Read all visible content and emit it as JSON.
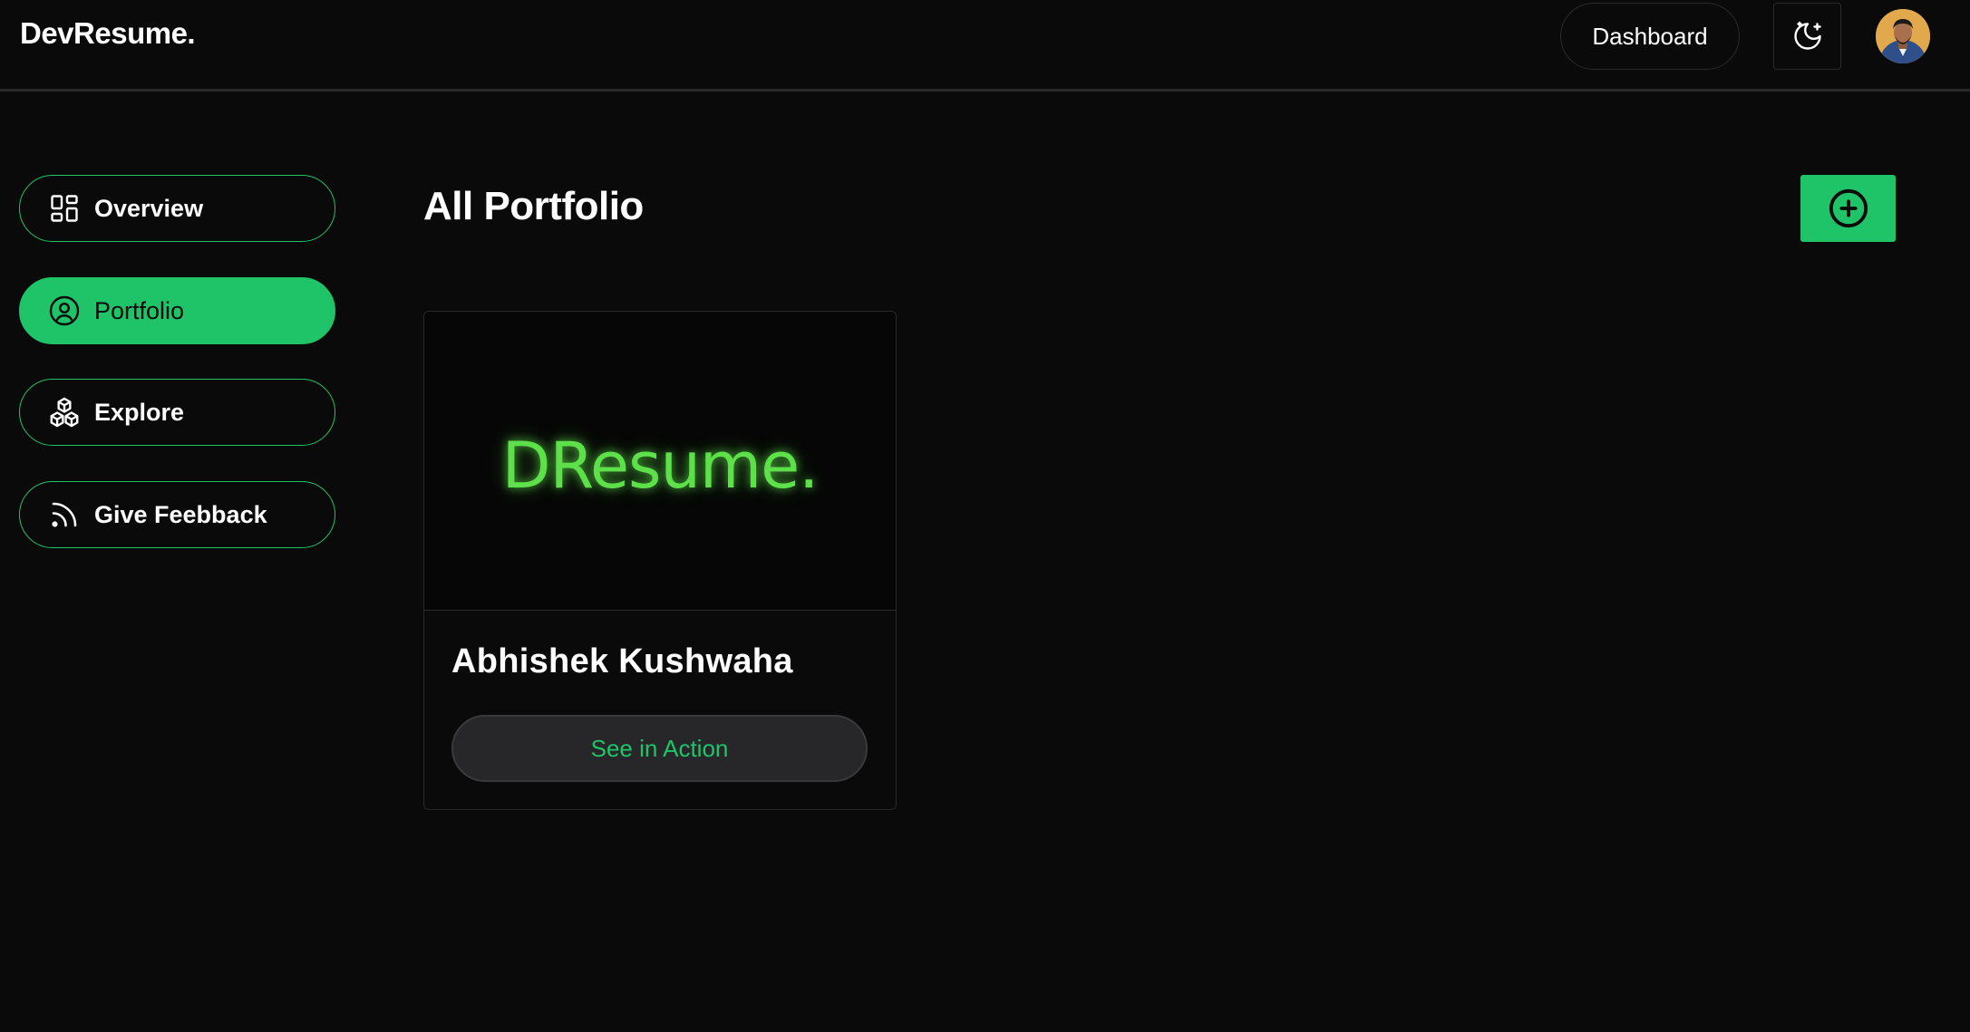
{
  "header": {
    "logo": "DevResume.",
    "dashboard_label": "Dashboard",
    "theme_icon": "moon-stars-icon",
    "avatar_alt": "avatar"
  },
  "sidebar": {
    "items": [
      {
        "label": "Overview",
        "icon": "layout-grid-icon",
        "active": false
      },
      {
        "label": "Portfolio",
        "icon": "user-circle-icon",
        "active": true
      },
      {
        "label": "Explore",
        "icon": "boxes-icon",
        "active": false
      },
      {
        "label": "Give Feebback",
        "icon": "rss-icon",
        "active": false
      }
    ]
  },
  "main": {
    "title": "All Portfolio",
    "add_icon": "plus-circle-icon",
    "portfolios": [
      {
        "thumbnail_text": "DResume.",
        "name": "Abhishek Kushwaha",
        "action_label": "See in Action"
      }
    ]
  },
  "colors": {
    "background": "#0a0a0a",
    "accent": "#1fc468",
    "thumb_glow": "#5ee04a",
    "border": "#2a2a2a",
    "button_dark": "#27272a"
  }
}
